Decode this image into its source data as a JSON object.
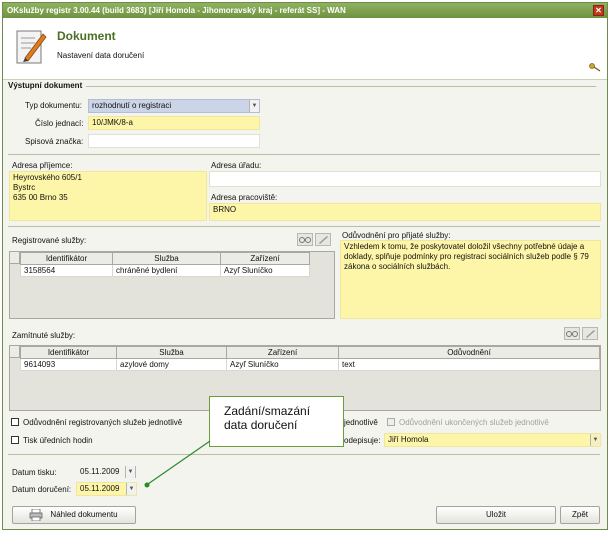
{
  "window": {
    "title": "OKslužby registr 3.00.44 (build 3683)  [Jiří Homola - Jihomoravský kraj - referát SS] - WAN",
    "close_icon": "close-icon"
  },
  "header": {
    "title": "Dokument",
    "subtitle": "Nastavení data doručení",
    "icon": "document-pen-icon",
    "key_icon": "key-icon"
  },
  "output_doc": {
    "section_title": "Výstupní dokument",
    "type_label": "Typ dokumentu:",
    "type_value": "rozhodnutí o registraci",
    "ref_label": "Číslo jednací:",
    "ref_value": "10/JMK/8-a",
    "file_label": "Spisová značka:",
    "file_value": ""
  },
  "addresses": {
    "recipient_label": "Adresa příjemce:",
    "recipient_lines": [
      "Heyrovského 605/1",
      "Bystrc",
      "635 00 Brno 35"
    ],
    "office_label": "Adresa úřadu:",
    "office_value": "",
    "workplace_label": "Adresa pracoviště:",
    "workplace_value": "BRNO"
  },
  "registered": {
    "label": "Registrované služby:",
    "columns": [
      "Identifikátor",
      "Služba",
      "Zařízení"
    ],
    "rows": [
      [
        "3158564",
        "chráněné bydlení",
        "Azyľ Sluníčko"
      ]
    ]
  },
  "justification": {
    "label": "Odůvodnění pro přijaté služby:",
    "text": "Vzhledem k tomu, že poskytovatel doložil všechny potřebné údaje a doklady, splňuje podmínky pro registraci sociálních služeb podle § 79 zákona o sociálních službách."
  },
  "rejected": {
    "label": "Zamítnuté služby:",
    "columns": [
      "Identifikátor",
      "Služba",
      "Zařízení",
      "Odůvodnění"
    ],
    "rows": [
      [
        "9614093",
        "azylové domy",
        "Azyľ Sluníčko",
        "text"
      ]
    ]
  },
  "options": {
    "individual_registered": "Odůvodnění registrovaných služeb jednotlivě",
    "individual_partial": "jednotlivě",
    "individual_terminated": "Odůvodnění ukončených služeb jednotlivě",
    "print_hours": "Tisk úředních hodin",
    "signer_label": "odepisuje:",
    "signer_value": "Jiří Homola"
  },
  "dates": {
    "print_label": "Datum tisku:",
    "print_value": "05.11.2009",
    "delivery_label": "Datum doručení:",
    "delivery_value": "05.11.2009"
  },
  "callout": {
    "text_line1": "Zadání/smazání",
    "text_line2": "data doručení"
  },
  "buttons": {
    "preview": "Náhled dokumentu",
    "save": "Uložit",
    "back": "Zpět"
  }
}
